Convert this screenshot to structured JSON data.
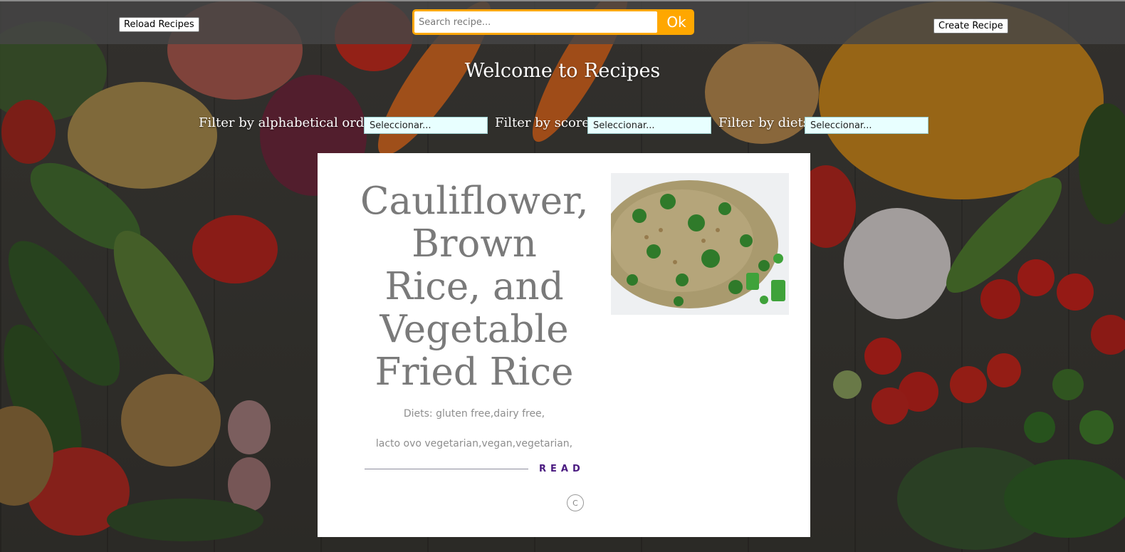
{
  "topbar": {
    "reload_label": "Reload Recipes",
    "search_placeholder": "Search recipe...",
    "search_value": "",
    "ok_label": "Ok",
    "create_label": "Create Recipe"
  },
  "welcome": "Welcome to Recipes",
  "filters": [
    {
      "label": "Filter by alphabetical order",
      "selected": "Seleccionar..."
    },
    {
      "label": "Filter by score",
      "selected": "Seleccionar..."
    },
    {
      "label": "Filter by diets",
      "selected": "Seleccionar..."
    }
  ],
  "recipe": {
    "title": "Cauliflower, Brown Rice, and Vegetable Fried Rice",
    "diets_line1": "Diets:  gluten free,dairy free,",
    "diets_line2": "lacto ovo vegetarian,vegan,vegetarian,",
    "read_label": "READ",
    "circle_label": "C",
    "image_icon": "fried-rice-photo"
  },
  "colors": {
    "accent": "#ffa700",
    "topbar": "#464646",
    "read": "#4a1a80",
    "select_bg": "#e8ffff"
  }
}
